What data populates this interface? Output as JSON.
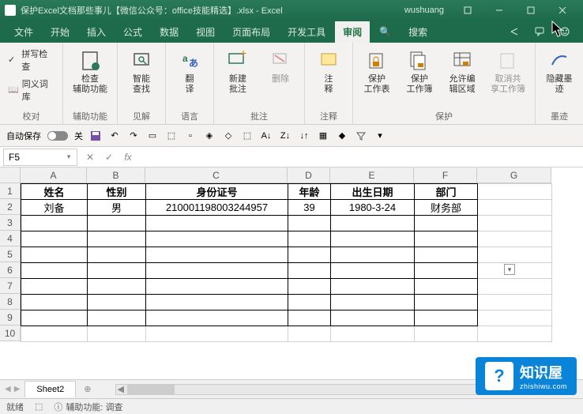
{
  "title": "保护Excel文档那些事儿【微信公众号：office技能精选】.xlsx - Excel",
  "user": "wushuang",
  "menu": {
    "file": "文件",
    "home": "开始",
    "insert": "插入",
    "formulas": "公式",
    "data": "数据",
    "view": "视图",
    "layout": "页面布局",
    "dev": "开发工具",
    "review": "审阅",
    "search_icon": "🔍",
    "search": "搜索"
  },
  "ribbon": {
    "proof": {
      "spell": "拼写检查",
      "thesaurus": "同义词库",
      "label": "校对"
    },
    "access": {
      "check": "检查\n辅助功能",
      "label": "辅助功能"
    },
    "insights": {
      "smart": "智能\n查找",
      "label": "见解"
    },
    "lang": {
      "translate": "翻\n译",
      "label": "语言"
    },
    "comments": {
      "new": "新建\n批注",
      "delete": "删除",
      "label": "批注"
    },
    "notes": {
      "note": "注\n释",
      "label": "注释"
    },
    "protect": {
      "sheet": "保护\n工作表",
      "workbook": "保护\n工作簿",
      "range": "允许编\n辑区域",
      "unshare": "取消共\n享工作簿",
      "label": "保护"
    },
    "ink": {
      "hide": "隐藏墨\n迹",
      "label": "墨迹"
    }
  },
  "qat": {
    "autosave": "自动保存",
    "off": "关"
  },
  "namebox": "F5",
  "cols": [
    "A",
    "B",
    "C",
    "D",
    "E",
    "F",
    "G"
  ],
  "rowCount": 10,
  "table": {
    "headers": {
      "A": "姓名",
      "B": "性别",
      "C": "身份证号",
      "D": "年龄",
      "E": "出生日期",
      "F": "部门"
    },
    "row2": {
      "A": "刘备",
      "B": "男",
      "C": "210001198003244957",
      "D": "39",
      "E": "1980-3-24",
      "F": "财务部"
    }
  },
  "sheet": "Sheet2",
  "status": {
    "ready": "就绪",
    "scroll": "",
    "access": "辅助功能: 调查"
  },
  "watermark": {
    "name": "知识屋",
    "url": "zhishiwu.com"
  }
}
